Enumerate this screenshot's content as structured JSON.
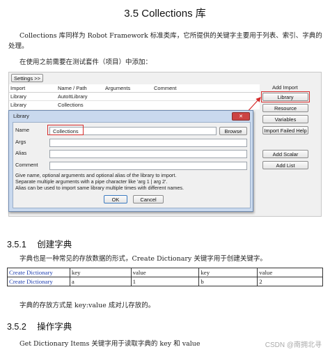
{
  "title": "3.5   Collections 库",
  "intro": "Collections 库同样为 Robot Framework 标准类库，它所提供的关键字主要用于列表、索引、字典的处理。",
  "intro_line1": "Collections 库同样为 Robot Framework 标准类库，它所提供的关键字主要用于列表、索引、字典的",
  "intro_line2": "处理。",
  "intro2": "在使用之前需要在测试套件（项目）中添加：",
  "ride": {
    "settings_button": "Settings >>",
    "headers": [
      "Import",
      "Name / Path",
      "Arguments",
      "Comment"
    ],
    "rows": [
      {
        "import": "Library",
        "name": "AutoItLibrary"
      },
      {
        "import": "Library",
        "name": "Collections"
      }
    ],
    "side_buttons": {
      "add_import": "Add Import",
      "library": "Library",
      "resource": "Resource",
      "variables": "Variables",
      "import_failed_help": "Import Failed Help",
      "add_scalar": "Add Scalar",
      "add_list": "Add List"
    }
  },
  "dialog": {
    "title": "Library",
    "close_glyph": "✕",
    "labels": {
      "name": "Name",
      "args": "Args",
      "alias": "Alias",
      "comment": "Comment"
    },
    "name_value": "Collections",
    "browse": "Browse",
    "help_line1": "Give name, optional arguments and optional alias of the library to import.",
    "help_line2": "Separate multiple arguments with a pipe character like 'arg 1 | arg 2'.",
    "help_line3": "Alias can be used to import same library multiple times with different names.",
    "ok": "OK",
    "cancel": "Cancel"
  },
  "section1": {
    "number": "3.5.1",
    "title": "创建字典",
    "text": "字典也是一种常见的存放数据的形式，Create Dictionary  关键字用于创建关键字。"
  },
  "dict_table": {
    "rows": [
      [
        "Create Dictionary",
        "key",
        "value",
        "key",
        "value"
      ],
      [
        "Create Dictionary",
        "a",
        "1",
        "b",
        "2"
      ]
    ]
  },
  "dict_note": "字典的存放方式是 key:value 成对儿存放的。",
  "section2": {
    "number": "3.5.2",
    "title": "操作字典",
    "text": "Get Dictionary Items  关键字用于读取字典的 key 和 value"
  },
  "watermark": "CSDN @南拥北寻",
  "colors": {
    "link": "#1f3fb0",
    "highlight_box": "#d62b2b",
    "dialog_frame": "#c9d9ee"
  }
}
